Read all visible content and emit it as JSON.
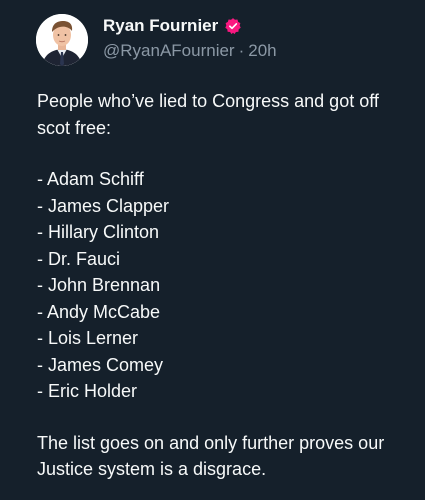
{
  "author": {
    "display_name": "Ryan Fournier",
    "handle": "@RyanAFournier",
    "separator": "·",
    "time": "20h",
    "verified_badge_color": "#f91880"
  },
  "tweet": {
    "intro": "People who’ve lied to Congress and got off scot free:",
    "list": [
      "- Adam Schiff",
      "- James Clapper",
      "- Hillary Clinton",
      "- Dr. Fauci",
      "- John Brennan",
      "- Andy McCabe",
      "- Lois Lerner",
      "- James Comey",
      "- Eric Holder"
    ],
    "outro": "The list goes on and only further proves our Justice system is a disgrace."
  },
  "theme": {
    "background": "#15202b",
    "text": "#f7f9f9",
    "muted": "#8b98a5"
  }
}
